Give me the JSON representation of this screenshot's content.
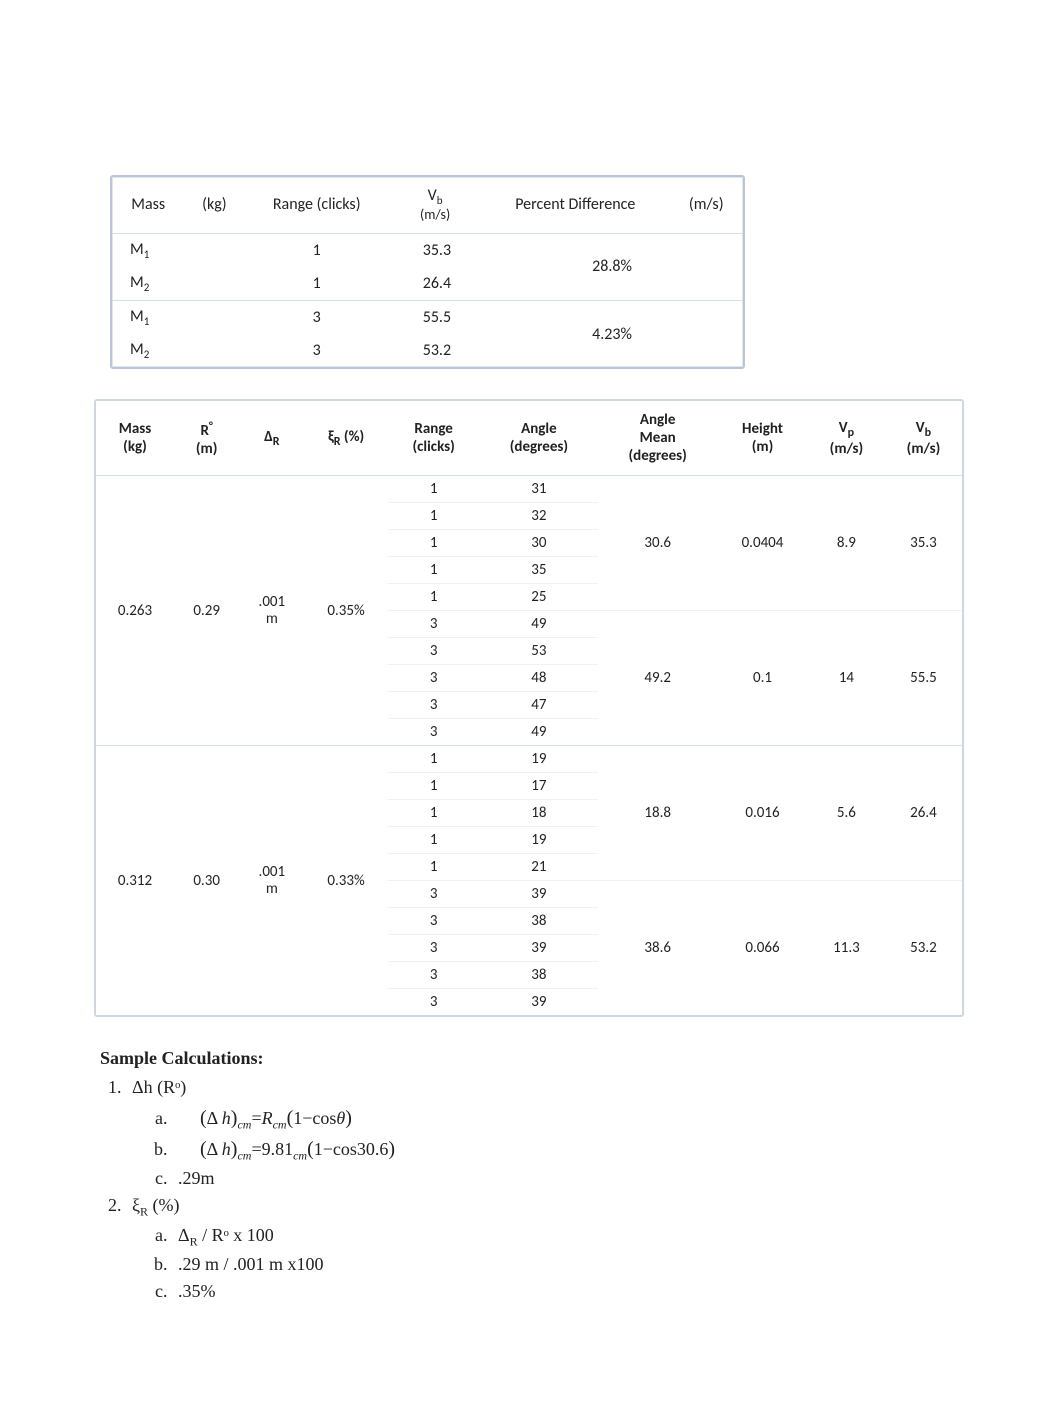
{
  "table1": {
    "headers": {
      "mass": "Mass",
      "kg": "(kg)",
      "range": "Range (clicks)",
      "vb": "V",
      "vb_sub": "b",
      "vb_unit": "(m/s)",
      "pd": "Percent Difference",
      "ms": "(m/s)"
    },
    "rows": [
      {
        "mass_main": "M",
        "mass_sub": "1",
        "range": "1",
        "vb": "35.3",
        "pd": "28.8%"
      },
      {
        "mass_main": "M",
        "mass_sub": "2",
        "range": "1",
        "vb": "26.4",
        "pd": ""
      },
      {
        "mass_main": "M",
        "mass_sub": "1",
        "range": "3",
        "vb": "55.5",
        "pd": "4.23%"
      },
      {
        "mass_main": "M",
        "mass_sub": "2",
        "range": "3",
        "vb": "53.2",
        "pd": ""
      }
    ]
  },
  "table2": {
    "headers": {
      "mass": "Mass",
      "mass_unit": "(kg)",
      "r": "R",
      "r_sup": "°",
      "r_unit": "(m)",
      "delta": "Δ",
      "delta_sub": "R",
      "xi": "ξ",
      "xi_sub": "R",
      "xi_unit": " (%)",
      "range": "Range",
      "range_unit": "(clicks)",
      "angle": "Angle",
      "angle_unit": "(degrees)",
      "angle_mean": "Angle",
      "angle_mean2": "Mean",
      "angle_mean_unit": "(degrees)",
      "height": "Height",
      "height_unit": "(m)",
      "vp": "V",
      "vp_sub": "p",
      "vp_unit": "(m/s)",
      "vb": "V",
      "vb_sub": "b",
      "vb_unit": "(m/s)"
    },
    "groups": [
      {
        "mass": "0.263",
        "r": "0.29",
        "delta": ".001",
        "delta_unit": "m",
        "xi": "0.35%",
        "subgroups": [
          {
            "angle_mean": "30.6",
            "height": "0.0404",
            "vp": "8.9",
            "vb": "35.3",
            "rows": [
              {
                "range": "1",
                "angle": "31"
              },
              {
                "range": "1",
                "angle": "32"
              },
              {
                "range": "1",
                "angle": "30"
              },
              {
                "range": "1",
                "angle": "35"
              },
              {
                "range": "1",
                "angle": "25"
              }
            ]
          },
          {
            "angle_mean": "49.2",
            "height": "0.1",
            "vp": "14",
            "vb": "55.5",
            "rows": [
              {
                "range": "3",
                "angle": "49"
              },
              {
                "range": "3",
                "angle": "53"
              },
              {
                "range": "3",
                "angle": "48"
              },
              {
                "range": "3",
                "angle": "47"
              },
              {
                "range": "3",
                "angle": "49"
              }
            ]
          }
        ]
      },
      {
        "mass": "0.312",
        "r": "0.30",
        "delta": ".001",
        "delta_unit": "m",
        "xi": "0.33%",
        "subgroups": [
          {
            "angle_mean": "18.8",
            "height": "0.016",
            "vp": "5.6",
            "vb": "26.4",
            "rows": [
              {
                "range": "1",
                "angle": "19"
              },
              {
                "range": "1",
                "angle": "17"
              },
              {
                "range": "1",
                "angle": "18"
              },
              {
                "range": "1",
                "angle": "19"
              },
              {
                "range": "1",
                "angle": "21"
              }
            ]
          },
          {
            "angle_mean": "38.6",
            "height": "0.066",
            "vp": "11.3",
            "vb": "53.2",
            "rows": [
              {
                "range": "3",
                "angle": "39"
              },
              {
                "range": "3",
                "angle": "38"
              },
              {
                "range": "3",
                "angle": "39"
              },
              {
                "range": "3",
                "angle": "38"
              },
              {
                "range": "3",
                "angle": "39"
              }
            ]
          }
        ]
      }
    ]
  },
  "calcs": {
    "heading": "Sample Calculations:",
    "item1_label": "Δh (Rᵒ)",
    "item1a_pre": "(Δ",
    "item1a_h": "h",
    "item1a_paren2": ")",
    "item1a_sub": "cm",
    "item1a_eq": "=",
    "item1a_R": "R",
    "item1a_rest": "(1−cos",
    "item1a_theta": "θ",
    "item1a_close": ")",
    "item1b_rest": "=9.81",
    "item1b_after": "(1−cos30.6)",
    "item1c": ".29m",
    "item2_label": "ξ",
    "item2_label_sub": "R",
    "item2_label_unit": " (%)",
    "item2a": "Δ",
    "item2a_sub": "R",
    "item2a_mid": "  / Rᵒ x 100",
    "item2b": ".29 m / .001 m x100",
    "item2c": ".35%"
  }
}
